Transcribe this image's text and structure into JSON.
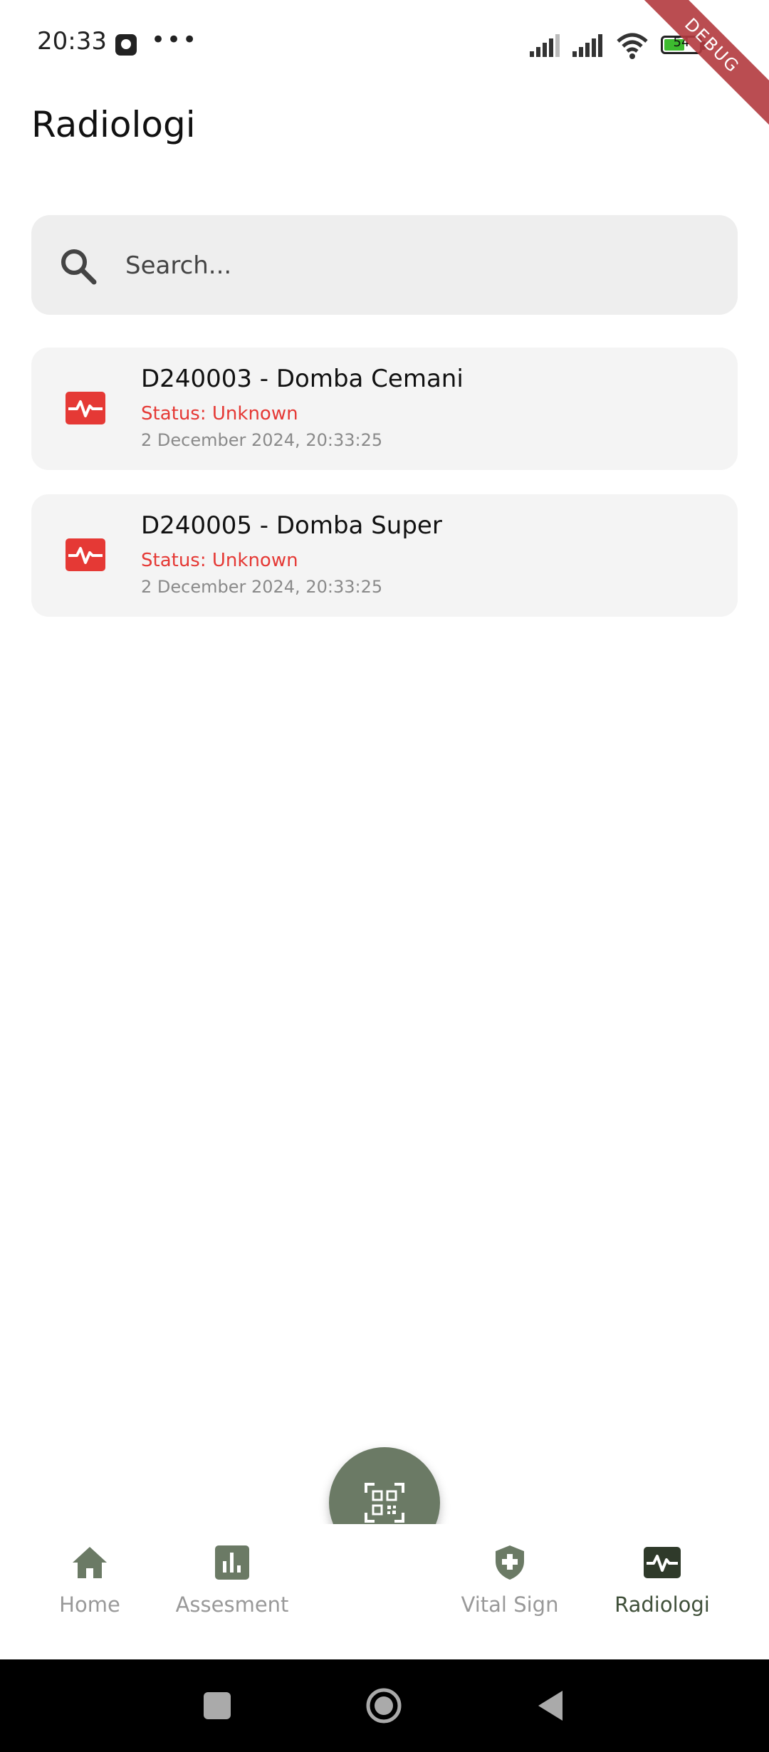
{
  "status_bar": {
    "time": "20:33",
    "battery": "54",
    "debug_label": "DEBUG"
  },
  "header": {
    "title": "Radiologi"
  },
  "search": {
    "placeholder": "Search..."
  },
  "records": [
    {
      "title": "D240003 - Domba Cemani",
      "status": "Status: Unknown",
      "date": "2 December 2024, 20:33:25"
    },
    {
      "title": "D240005 - Domba Super",
      "status": "Status: Unknown",
      "date": "2 December 2024, 20:33:25"
    }
  ],
  "bottom_nav": {
    "items": [
      {
        "label": "Home",
        "icon": "home-icon"
      },
      {
        "label": "Assesment",
        "icon": "bar-chart-icon"
      },
      {
        "label": "Vital Sign",
        "icon": "shield-plus-icon"
      },
      {
        "label": "Radiologi",
        "icon": "pulse-monitor-icon"
      }
    ],
    "active": "Radiologi",
    "fab_icon": "qr-scan-icon"
  },
  "colors": {
    "accent": "#6b7a65",
    "status_red": "#e53935",
    "active_nav": "#40503a",
    "card_bg": "#f4f4f4"
  }
}
